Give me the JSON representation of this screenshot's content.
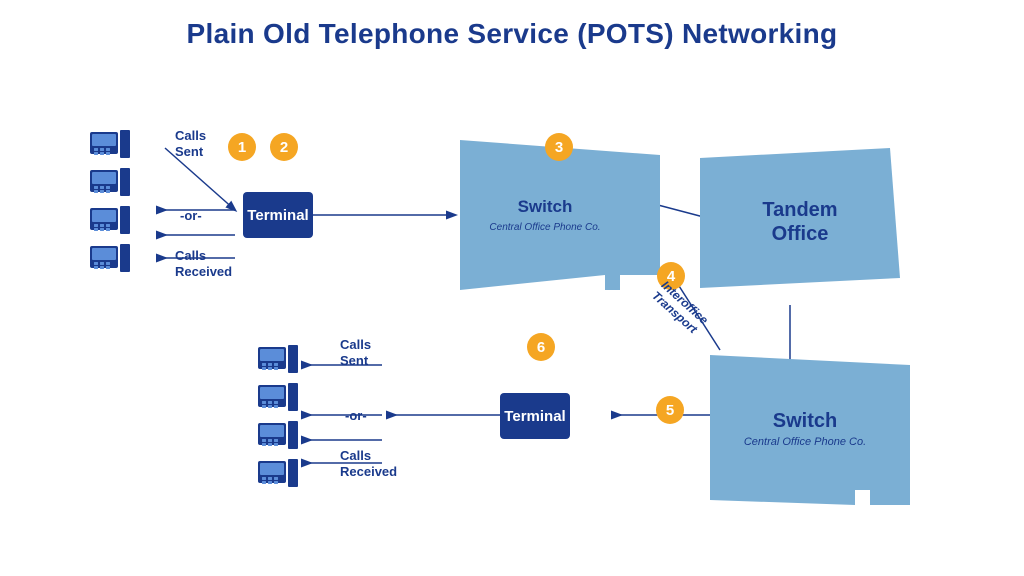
{
  "title": "Plain Old Telephone Service (POTS) Networking",
  "badges": [
    {
      "id": 1,
      "label": "1"
    },
    {
      "id": 2,
      "label": "2"
    },
    {
      "id": 3,
      "label": "3"
    },
    {
      "id": 4,
      "label": "4"
    },
    {
      "id": 5,
      "label": "5"
    },
    {
      "id": 6,
      "label": "6"
    }
  ],
  "terminal1": "Terminal",
  "terminal2": "Terminal",
  "switch1": {
    "main": "Switch",
    "sub": "Central Office Phone Co."
  },
  "switch2": {
    "main": "Switch",
    "sub": "Central Office Phone Co."
  },
  "tandem": {
    "main": "Tandem",
    "sub": "Office"
  },
  "labels": {
    "calls_sent_top": "Calls\nSent",
    "or_top": "-or-",
    "calls_received_top": "Calls\nReceived",
    "calls_sent_bottom": "Calls\nSent",
    "or_bottom": "-or-",
    "calls_received_bottom": "Calls\nReceived",
    "interoffice": "Interoffice\nTransport"
  }
}
